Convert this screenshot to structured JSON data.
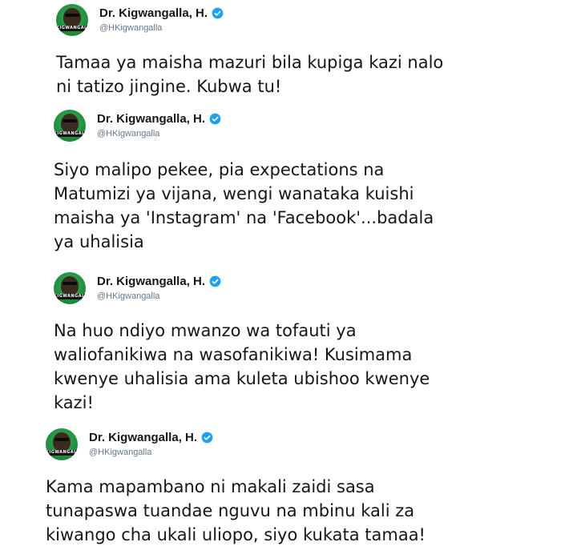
{
  "tweets": [
    {
      "author_name": "Dr. Kigwangalla, H.",
      "handle": "@HKigwangalla",
      "avatar_band_text": "KIGWANGALL",
      "text": "Tamaa ya maisha mazuri bila kupiga kazi nalo\nni tatizo jingine. Kubwa tu!"
    },
    {
      "author_name": "Dr. Kigwangalla, H.",
      "handle": "@HKigwangalla",
      "avatar_band_text": "KIGWANGALL",
      "text": "Siyo malipo pekee, pia expectations na\nMatumizi ya vijana, wengi wanataka kuishi\nmaisha ya 'Instagram' na 'Facebook'...badala\nya uhalisia"
    },
    {
      "author_name": "Dr. Kigwangalla, H.",
      "handle": "@HKigwangalla",
      "avatar_band_text": "KIGWANGALL",
      "text": "Na huo ndiyo mwanzo wa tofauti ya\nwaliofanikiwa na wasofanikiwa! Kusimama\nkwenye uhalisia ama kuleta ubishoo kwenye\nkazi!"
    },
    {
      "author_name": "Dr. Kigwangalla, H.",
      "handle": "@HKigwangalla",
      "avatar_band_text": "KIGWANGALL",
      "text": "Kama mapambano ni makali zaidi sasa\ntunapaswa tuandae nguvu na mbinu kali za\nkiwango cha ukali uliopo, siyo kukata tamaa!"
    }
  ],
  "colors": {
    "verified": "#1da1f2",
    "handle": "#657786",
    "text": "#14171a",
    "avatar_green": "#1f8f3e"
  }
}
